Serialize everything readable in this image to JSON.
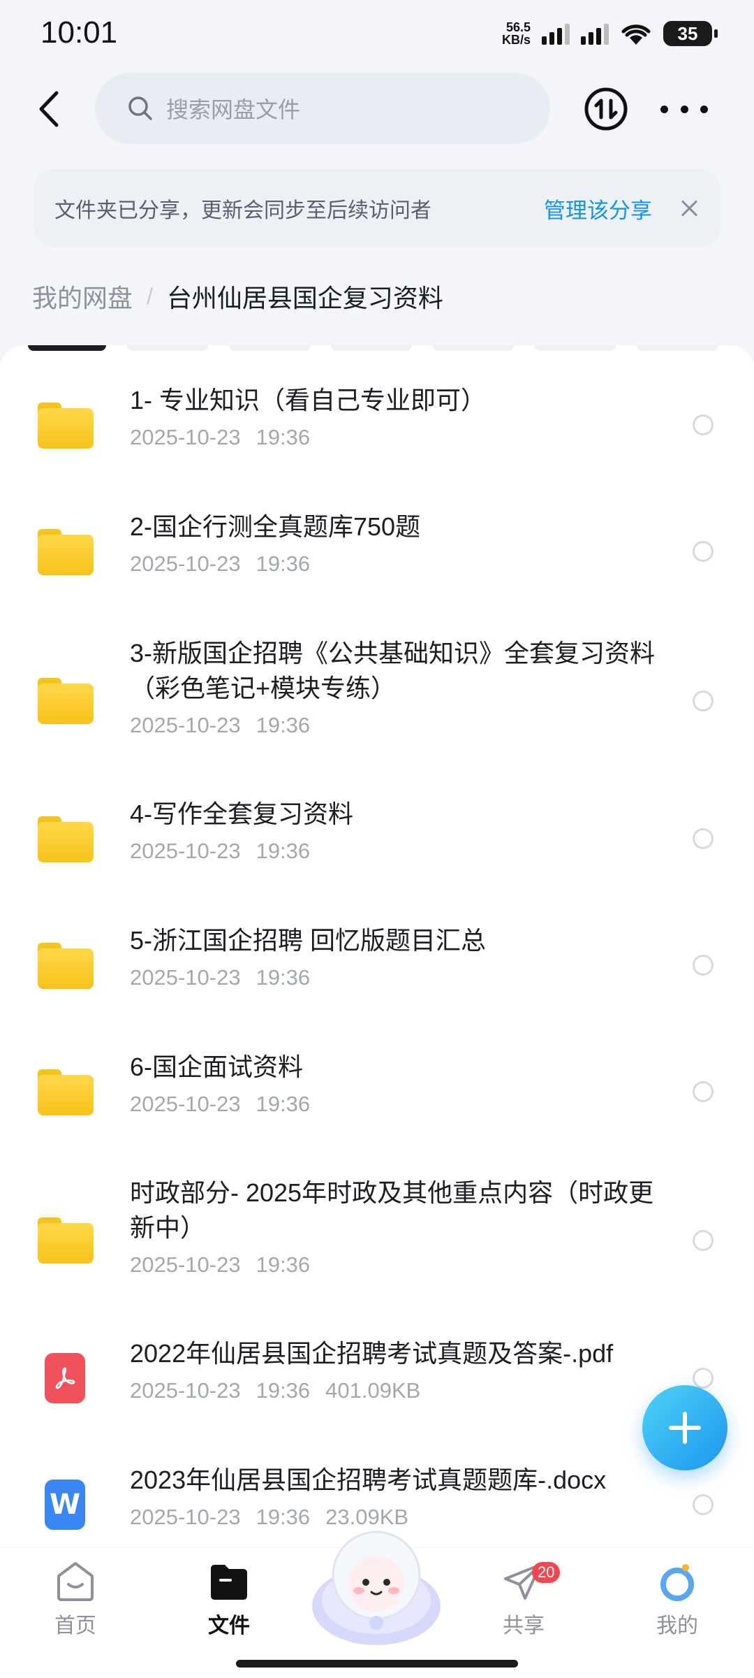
{
  "status_bar": {
    "time": "10:01",
    "net_speed_value": "56.5",
    "net_speed_unit": "KB/s",
    "battery": "35"
  },
  "header": {
    "search_placeholder": "搜索网盘文件"
  },
  "notice": {
    "text": "文件夹已分享，更新会同步至后续访问者",
    "action": "管理该分享"
  },
  "breadcrumb": {
    "root": "我的网盘",
    "separator": "/",
    "current": "台州仙居县国企复习资料"
  },
  "files": [
    {
      "name": "1- 专业知识（看自己专业即可）",
      "date": "2025-10-23",
      "time": "19:36",
      "size": "",
      "icon": "folder-icon"
    },
    {
      "name": "2-国企行测全真题库750题",
      "date": "2025-10-23",
      "time": "19:36",
      "size": "",
      "icon": "folder-icon"
    },
    {
      "name": "3-新版国企招聘《公共基础知识》全套复习资料（彩色笔记+模块专练）",
      "date": "2025-10-23",
      "time": "19:36",
      "size": "",
      "icon": "folder-icon"
    },
    {
      "name": "4-写作全套复习资料",
      "date": "2025-10-23",
      "time": "19:36",
      "size": "",
      "icon": "folder-icon"
    },
    {
      "name": "5-浙江国企招聘 回忆版题目汇总",
      "date": "2025-10-23",
      "time": "19:36",
      "size": "",
      "icon": "folder-icon"
    },
    {
      "name": "6-国企面试资料",
      "date": "2025-10-23",
      "time": "19:36",
      "size": "",
      "icon": "folder-icon"
    },
    {
      "name": "时政部分- 2025年时政及其他重点内容（时政更新中）",
      "date": "2025-10-23",
      "time": "19:36",
      "size": "",
      "icon": "folder-icon"
    },
    {
      "name": "2022年仙居县国企招聘考试真题及答案-.pdf",
      "date": "2025-10-23",
      "time": "19:36",
      "size": "401.09KB",
      "icon": "pdf-icon"
    },
    {
      "name": "2023年仙居县国企招聘考试真题题库-.docx",
      "date": "2025-10-23",
      "time": "19:36",
      "size": "23.09KB",
      "icon": "word-doc-icon"
    }
  ],
  "tabs": {
    "home": "首页",
    "files": "文件",
    "share": "共享",
    "share_badge": "20",
    "me": "我的"
  },
  "colors": {
    "accent": "#1592e6",
    "folder": "#f7c21a",
    "pdf": "#f1515a",
    "doc": "#3a86f2"
  }
}
